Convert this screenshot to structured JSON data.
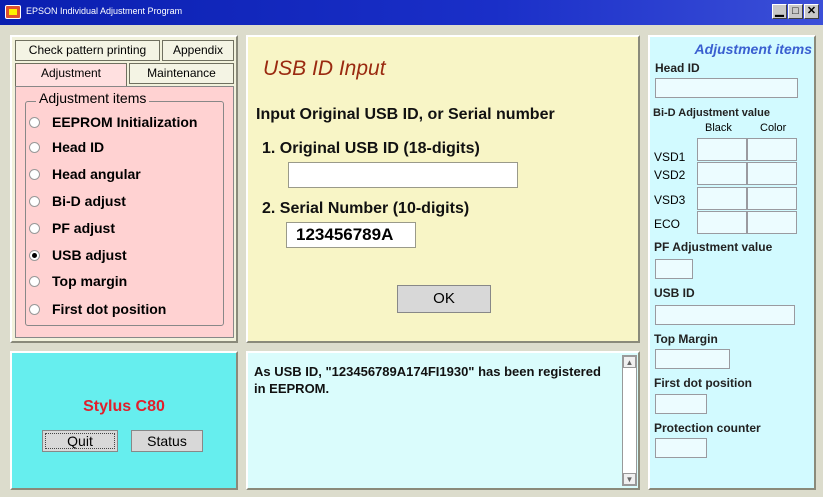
{
  "window": {
    "title": "EPSON Individual Adjustment Program",
    "buttons": [
      "▁",
      "□",
      "✕"
    ]
  },
  "tabs": {
    "row1": [
      "Check pattern printing",
      "Appendix"
    ],
    "row2": [
      "Adjustment",
      "Maintenance"
    ],
    "active": "Adjustment"
  },
  "adjustment_items": {
    "title": "Adjustment items",
    "items": [
      "EEPROM Initialization",
      "Head ID",
      "Head angular",
      "Bi-D adjust",
      "PF adjust",
      "USB adjust",
      "Top margin",
      "First dot position"
    ],
    "selected": "USB adjust"
  },
  "usb_input": {
    "title": "USB ID Input",
    "instruction": "Input Original USB ID, or Serial number",
    "usb_id_label": "1. Original USB ID (18-digits)",
    "usb_id_value": "",
    "serial_label": "2. Serial Number (10-digits)",
    "serial_value": "123456789A",
    "ok_label": "OK"
  },
  "message": {
    "text": "As USB ID, \"123456789A174FI1930\" has been registered in EEPROM."
  },
  "model": {
    "name": "Stylus C80",
    "quit_label": "Quit",
    "status_label": "Status"
  },
  "right_panel": {
    "title": "Adjustment items",
    "head_id_label": "Head ID",
    "bid_label": "Bi-D Adjustment value",
    "col_black": "Black",
    "col_color": "Color",
    "rows": [
      "VSD1",
      "VSD2",
      "VSD3",
      "ECO"
    ],
    "pf_label": "PF Adjustment value",
    "usb_id_label": "USB ID",
    "top_margin_label": "Top Margin",
    "first_dot_label": "First dot position",
    "protection_label": "Protection counter"
  },
  "colors": {
    "title_bar": "#0a1fb0",
    "model_name": "#e0202c",
    "usb_title": "#9a2a10",
    "right_title": "#3a5fd0"
  }
}
